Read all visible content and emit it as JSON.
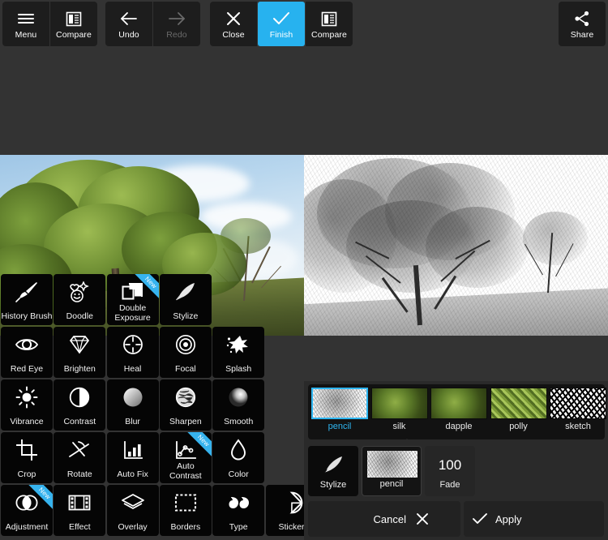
{
  "app": {
    "accent_color": "#27b2ef",
    "panel_color": "#2a2a2a",
    "tile_color": "#050505"
  },
  "toolbar": {
    "groups": [
      {
        "buttons": [
          {
            "label": "Menu",
            "icon": "hamburger-menu-icon",
            "state": "normal"
          },
          {
            "label": "Compare",
            "icon": "compare-split-icon",
            "state": "normal"
          }
        ]
      },
      {
        "buttons": [
          {
            "label": "Undo",
            "icon": "arrow-left-icon",
            "state": "normal"
          },
          {
            "label": "Redo",
            "icon": "arrow-right-icon",
            "state": "disabled"
          }
        ]
      },
      {
        "buttons": [
          {
            "label": "Close",
            "icon": "close-x-icon",
            "state": "normal"
          },
          {
            "label": "Finish",
            "icon": "checkmark-icon",
            "state": "active"
          },
          {
            "label": "Compare",
            "icon": "compare-split-icon",
            "state": "normal"
          }
        ]
      },
      {
        "buttons": [
          {
            "label": "Share",
            "icon": "share-node-icon",
            "state": "normal"
          }
        ]
      }
    ]
  },
  "stage": {
    "left_preview_label": "original-color-photo",
    "right_preview_label": "pencil-sketch-preview"
  },
  "tool_grid": {
    "rows": [
      [
        {
          "label": "History Brush",
          "icon": "paint-brush-icon",
          "new": false,
          "two_line": false
        },
        {
          "label": "Doodle",
          "icon": "doodle-stars-icon",
          "new": false,
          "two_line": false
        },
        {
          "label": "Double Exposure",
          "icon": "double-frames-icon",
          "new": true,
          "two_line": true
        },
        {
          "label": "Stylize",
          "icon": "feather-quill-icon",
          "new": false,
          "two_line": false
        }
      ],
      [
        {
          "label": "Red Eye",
          "icon": "eye-icon",
          "new": false,
          "two_line": false
        },
        {
          "label": "Brighten",
          "icon": "diamond-icon",
          "new": false,
          "two_line": false
        },
        {
          "label": "Heal",
          "icon": "crosshair-icon",
          "new": false,
          "two_line": false
        },
        {
          "label": "Focal",
          "icon": "concentric-circles-icon",
          "new": false,
          "two_line": false
        },
        {
          "label": "Splash",
          "icon": "splash-drop-icon",
          "new": false,
          "two_line": false
        }
      ],
      [
        {
          "label": "Vibrance",
          "icon": "sun-rays-icon",
          "new": false,
          "two_line": false
        },
        {
          "label": "Contrast",
          "icon": "half-circle-icon",
          "new": false,
          "two_line": false
        },
        {
          "label": "Blur",
          "icon": "gradient-sphere-icon",
          "new": false,
          "two_line": false
        },
        {
          "label": "Sharpen",
          "icon": "sharpen-sphere-icon",
          "new": false,
          "two_line": false
        },
        {
          "label": "Smooth",
          "icon": "smooth-sphere-icon",
          "new": false,
          "two_line": false
        }
      ],
      [
        {
          "label": "Crop",
          "icon": "crop-frame-icon",
          "new": false,
          "two_line": false
        },
        {
          "label": "Rotate",
          "icon": "rotate-axis-icon",
          "new": false,
          "two_line": false
        },
        {
          "label": "Auto Fix",
          "icon": "bar-chart-icon",
          "new": false,
          "two_line": false
        },
        {
          "label": "Auto Contrast",
          "icon": "curve-points-icon",
          "new": true,
          "two_line": true
        },
        {
          "label": "Color",
          "icon": "water-drop-icon",
          "new": false,
          "two_line": false
        }
      ],
      [
        {
          "label": "Adjustment",
          "icon": "overlap-circles-icon",
          "new": true,
          "two_line": false
        },
        {
          "label": "Effect",
          "icon": "film-strip-icon",
          "new": false,
          "two_line": false
        },
        {
          "label": "Overlay",
          "icon": "layers-icon",
          "new": false,
          "two_line": false
        },
        {
          "label": "Borders",
          "icon": "dashed-frame-icon",
          "new": false,
          "two_line": false
        },
        {
          "label": "Type",
          "icon": "quote-marks-icon",
          "new": false,
          "two_line": false
        },
        {
          "label": "Sticker",
          "icon": "circle-sticker-icon",
          "new": false,
          "two_line": false
        }
      ]
    ]
  },
  "effect_panel": {
    "presets": [
      {
        "label": "pencil",
        "selected": true,
        "style": "sketch-light"
      },
      {
        "label": "silk",
        "selected": false,
        "style": "color-soft"
      },
      {
        "label": "dapple",
        "selected": false,
        "style": "color-soft"
      },
      {
        "label": "polly",
        "selected": false,
        "style": "color-posterized"
      },
      {
        "label": "sketch",
        "selected": false,
        "style": "sketch-high-contrast"
      }
    ],
    "controls": {
      "stylize": {
        "label": "Stylize",
        "icon": "feather-quill-icon"
      },
      "preset": {
        "label": "pencil",
        "icon": "preset-thumbnail"
      },
      "fade": {
        "label": "Fade",
        "value": "100"
      }
    },
    "actions": {
      "cancel": {
        "label": "Cancel",
        "icon": "close-x-icon"
      },
      "apply": {
        "label": "Apply",
        "icon": "checkmark-icon"
      }
    }
  }
}
